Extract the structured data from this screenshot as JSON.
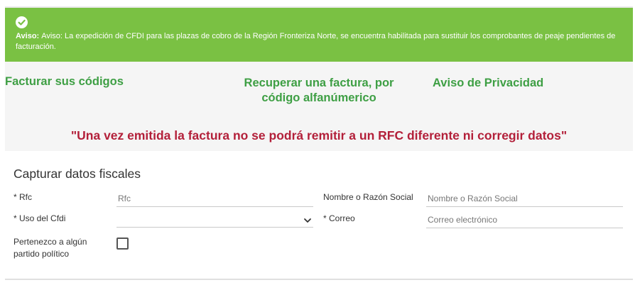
{
  "alert": {
    "icon": "check-circle-icon",
    "bold_label": "Aviso:",
    "text": "Aviso: La expedición de CFDI para las plazas de cobro de la Región Fronteriza Norte, se encuentra habilitada para sustituir los comprobantes de peaje pendientes de facturación.",
    "background_color": "#7ac143"
  },
  "nav": {
    "facturar": "Facturar sus códigos",
    "recuperar": "Recuperar una factura, por código alfanúmerico",
    "aviso": "Aviso de Privacidad",
    "link_color": "#3e9f44"
  },
  "warning": "\"Una vez emitida la factura no se podrá remitir a un RFC diferente ni corregir datos\"",
  "form": {
    "title": "Capturar datos fiscales",
    "rfc": {
      "label": "* Rfc",
      "placeholder": "Rfc",
      "value": ""
    },
    "nombre": {
      "label": "Nombre o Razón Social",
      "placeholder": "Nombre o Razón Social",
      "value": ""
    },
    "uso_cfdi": {
      "label": "* Uso del Cfdi",
      "selected": "",
      "icon": "chevron-down-icon"
    },
    "correo": {
      "label": "* Correo",
      "placeholder": "Correo electrónico",
      "value": ""
    },
    "partido": {
      "label": "Pertenezco a algún partido político",
      "checked": false
    }
  }
}
